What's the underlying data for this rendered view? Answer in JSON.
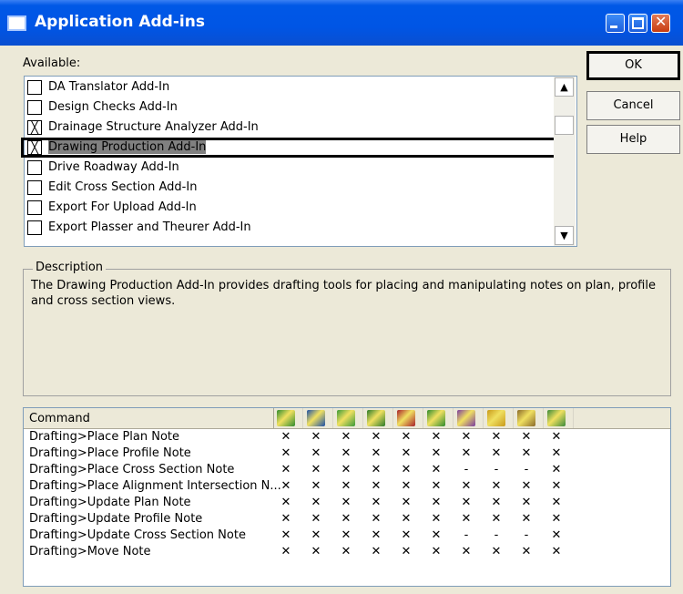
{
  "window": {
    "title": "Application Add-ins"
  },
  "available": {
    "label": "Available:",
    "items": [
      {
        "label": "DA Translator Add-In",
        "checked": false
      },
      {
        "label": "Design Checks Add-In",
        "checked": false
      },
      {
        "label": "Drainage Structure Analyzer Add-In",
        "checked": true
      },
      {
        "label": "Drawing Production Add-In",
        "checked": true,
        "selected": true
      },
      {
        "label": "Drive Roadway Add-In",
        "checked": false
      },
      {
        "label": "Edit Cross Section Add-In",
        "checked": false
      },
      {
        "label": "Export For Upload Add-In",
        "checked": false
      },
      {
        "label": "Export Plasser and Theurer Add-In",
        "checked": false
      }
    ]
  },
  "buttons": {
    "ok": "OK",
    "cancel": "Cancel",
    "help": "Help"
  },
  "description": {
    "title": "Description",
    "text": "The Drawing Production Add-In provides drafting tools for placing and manipulating notes on plan, profile and cross section views."
  },
  "commands": {
    "header": "Command",
    "icon_colors": [
      "#2e8b2e",
      "#1c4fa8",
      "#3a9a3a",
      "#2a7a2a",
      "#a8202a",
      "#2e8b2e",
      "#7a3ca0",
      "#c89a1a",
      "#8a6a2a",
      "#3a8a3a"
    ],
    "rows": [
      {
        "name": "Drafting>Place Plan Note",
        "marks": [
          "X",
          "X",
          "X",
          "X",
          "X",
          "X",
          "X",
          "X",
          "X",
          "X"
        ]
      },
      {
        "name": "Drafting>Place Profile Note",
        "marks": [
          "X",
          "X",
          "X",
          "X",
          "X",
          "X",
          "X",
          "X",
          "X",
          "X"
        ]
      },
      {
        "name": "Drafting>Place Cross Section Note",
        "marks": [
          "X",
          "X",
          "X",
          "X",
          "X",
          "X",
          "-",
          "-",
          "-",
          "X"
        ]
      },
      {
        "name": "Drafting>Place Alignment Intersection N...",
        "marks": [
          "X",
          "X",
          "X",
          "X",
          "X",
          "X",
          "X",
          "X",
          "X",
          "X"
        ]
      },
      {
        "name": "Drafting>Update Plan Note",
        "marks": [
          "X",
          "X",
          "X",
          "X",
          "X",
          "X",
          "X",
          "X",
          "X",
          "X"
        ]
      },
      {
        "name": "Drafting>Update Profile Note",
        "marks": [
          "X",
          "X",
          "X",
          "X",
          "X",
          "X",
          "X",
          "X",
          "X",
          "X"
        ]
      },
      {
        "name": "Drafting>Update Cross Section Note",
        "marks": [
          "X",
          "X",
          "X",
          "X",
          "X",
          "X",
          "-",
          "-",
          "-",
          "X"
        ]
      },
      {
        "name": "Drafting>Move Note",
        "marks": [
          "X",
          "X",
          "X",
          "X",
          "X",
          "X",
          "X",
          "X",
          "X",
          "X"
        ]
      }
    ]
  }
}
